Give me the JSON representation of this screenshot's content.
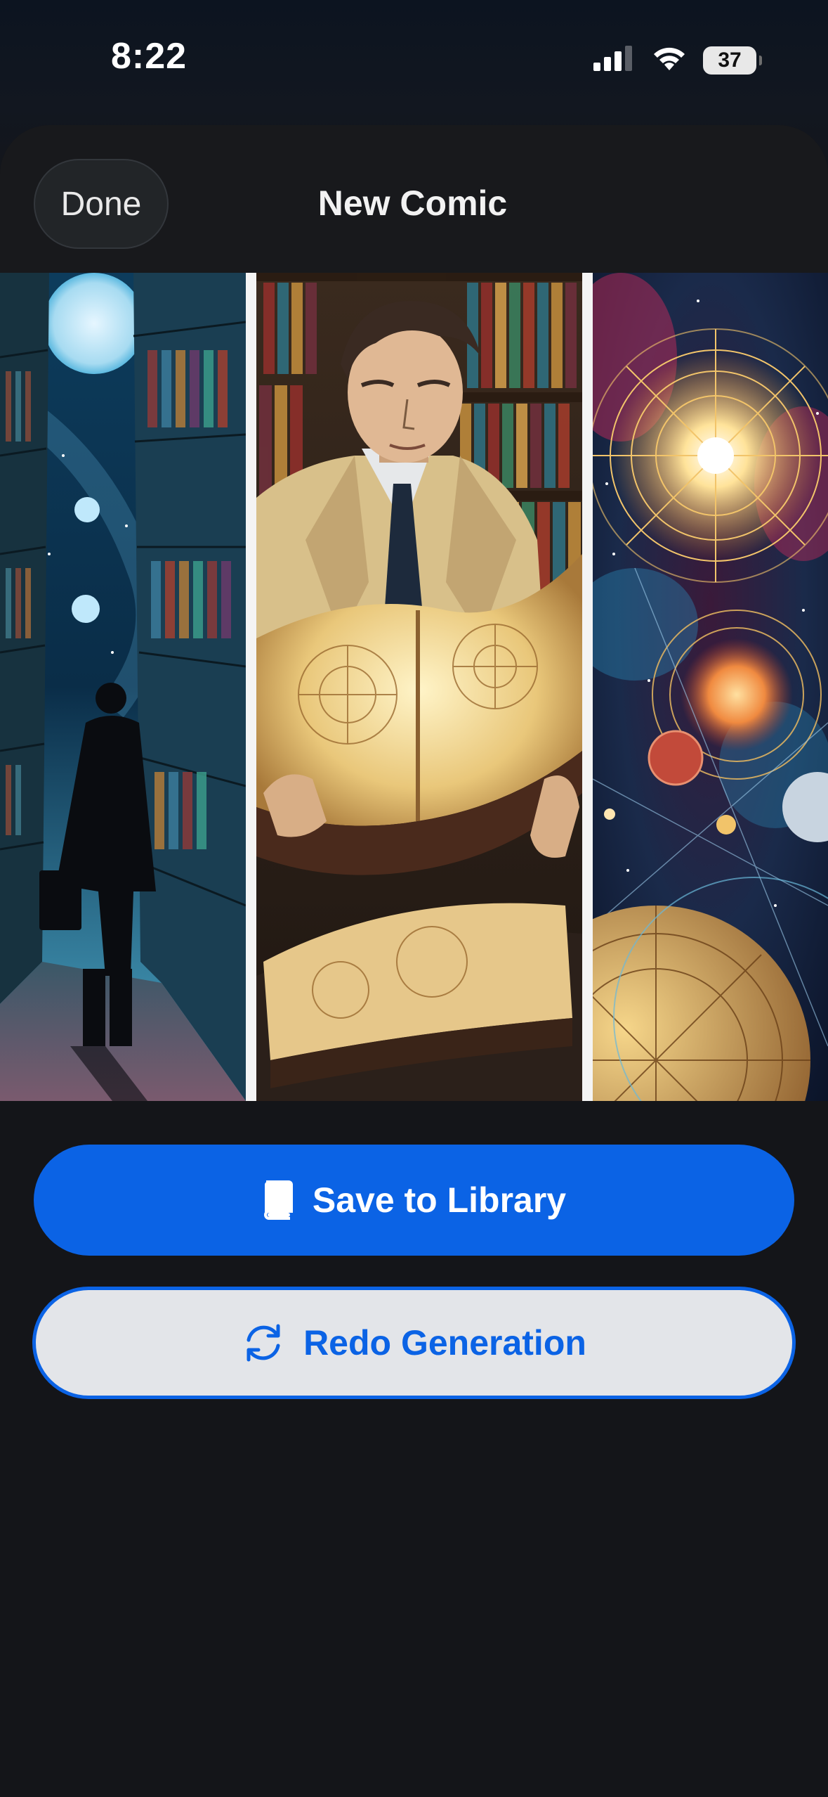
{
  "status_bar": {
    "time": "8:22",
    "battery_level": "37",
    "icons": [
      "signal-icon",
      "wifi-icon",
      "battery-icon"
    ]
  },
  "sheet": {
    "title": "New Comic",
    "done_label": "Done"
  },
  "comic": {
    "panels": [
      {
        "name": "library-aisle-panel",
        "description_icon": "figure-in-library"
      },
      {
        "name": "reading-book-panel",
        "description_icon": "man-reading-book"
      },
      {
        "name": "cosmic-map-panel",
        "description_icon": "celestial-map"
      }
    ]
  },
  "actions": {
    "save_label": "Save to Library",
    "save_icon": "book-icon",
    "redo_label": "Redo Generation",
    "redo_icon": "refresh-icon"
  },
  "colors": {
    "accent": "#0b63e5",
    "background": "#141519",
    "redo_background": "#e3e5e9"
  }
}
